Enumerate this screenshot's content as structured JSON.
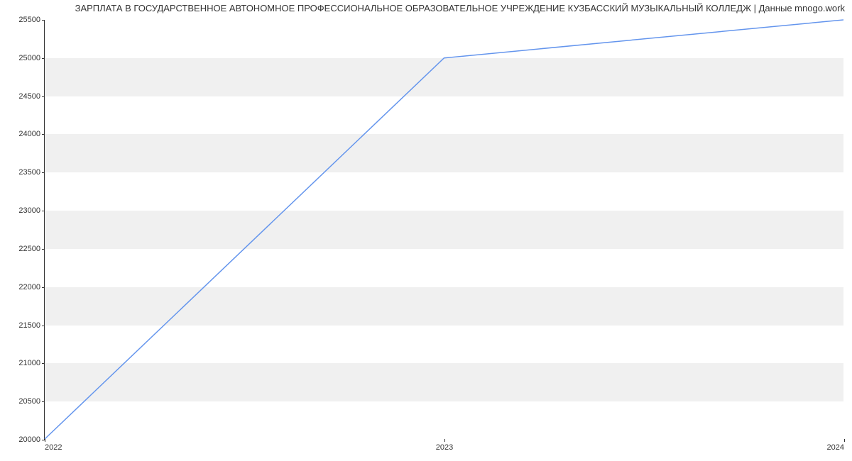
{
  "chart_data": {
    "type": "line",
    "title": "ЗАРПЛАТА В ГОСУДАРСТВЕННОЕ АВТОНОМНОЕ ПРОФЕССИОНАЛЬНОЕ ОБРАЗОВАТЕЛЬНОЕ УЧРЕЖДЕНИЕ КУЗБАССКИЙ МУЗЫКАЛЬНЫЙ КОЛЛЕДЖ | Данные mnogo.work",
    "xlabel": "",
    "ylabel": "",
    "x": [
      "2022",
      "2023",
      "2024"
    ],
    "values": [
      20000,
      25000,
      25500
    ],
    "ylim": [
      20000,
      25500
    ],
    "y_ticks": [
      20000,
      20500,
      21000,
      21500,
      22000,
      22500,
      23000,
      23500,
      24000,
      24500,
      25000,
      25500
    ],
    "x_ticks": [
      "2022",
      "2023",
      "2024"
    ]
  }
}
